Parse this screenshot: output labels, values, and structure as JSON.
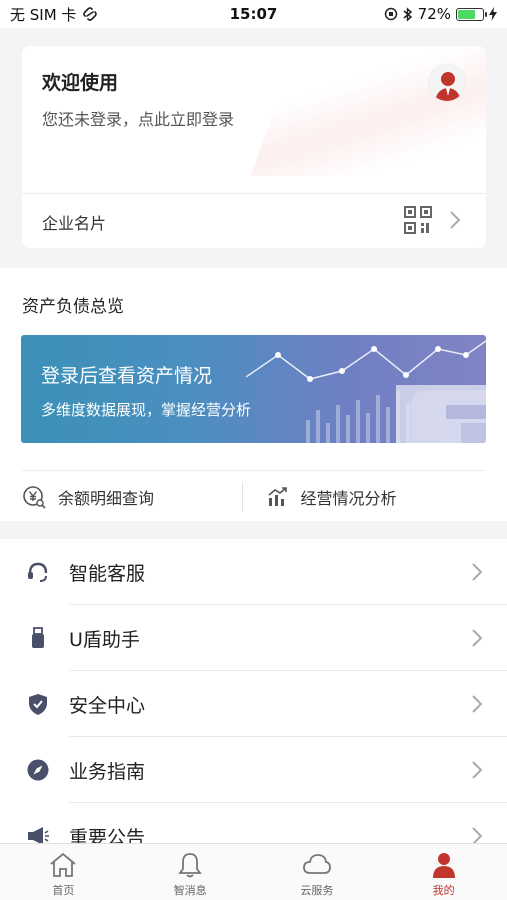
{
  "status_bar": {
    "carrier": "无 SIM 卡",
    "time": "15:07",
    "battery_percent": "72%",
    "battery_level": 0.72
  },
  "profile": {
    "title": "欢迎使用",
    "subtitle": "您还未登录，点此立即登录",
    "business_card_label": "企业名片"
  },
  "assets": {
    "section_title": "资产负债总览",
    "banner_title": "登录后查看资产情况",
    "banner_subtitle": "多维度数据展现，掌握经营分析",
    "quick_links": [
      {
        "label": "余额明细查询",
        "icon": "yen-search-icon"
      },
      {
        "label": "经营情况分析",
        "icon": "bar-chart-icon"
      }
    ]
  },
  "menu": {
    "items": [
      {
        "label": "智能客服",
        "icon": "headset-icon"
      },
      {
        "label": "U盾助手",
        "icon": "usb-key-icon"
      },
      {
        "label": "安全中心",
        "icon": "shield-check-icon"
      },
      {
        "label": "业务指南",
        "icon": "compass-icon"
      },
      {
        "label": "重要公告",
        "icon": "megaphone-icon"
      }
    ]
  },
  "tabs": {
    "items": [
      {
        "label": "首页",
        "icon": "home-icon"
      },
      {
        "label": "智消息",
        "icon": "bell-icon"
      },
      {
        "label": "云服务",
        "icon": "cloud-icon"
      },
      {
        "label": "我的",
        "icon": "person-icon"
      }
    ],
    "active_color": "#c0362c"
  }
}
